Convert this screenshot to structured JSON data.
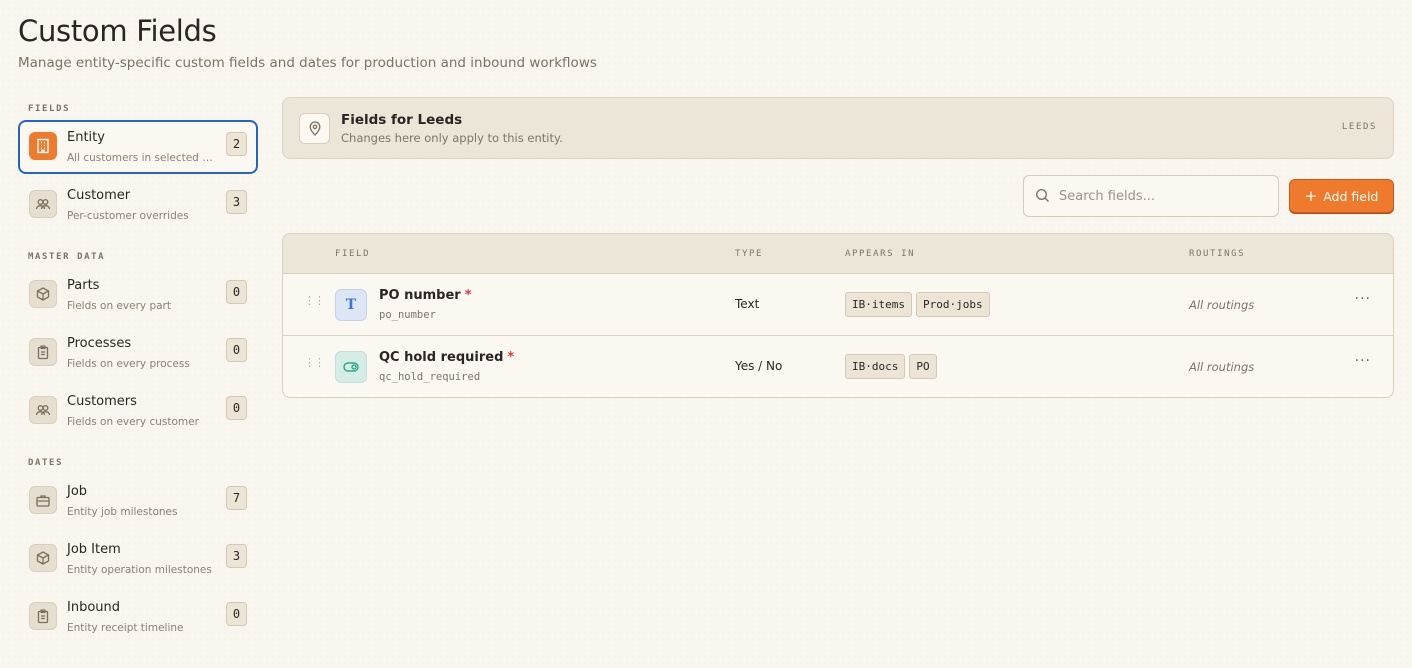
{
  "page": {
    "title": "Custom Fields",
    "subtitle": "Manage entity-specific custom fields and dates for production and inbound workflows"
  },
  "sidebar": {
    "sections": [
      {
        "heading": "FIELDS",
        "items": [
          {
            "label": "Entity",
            "sub": "All customers in selected entity",
            "count": "2",
            "icon": "building-icon",
            "active": true
          },
          {
            "label": "Customer",
            "sub": "Per-customer overrides",
            "count": "3",
            "icon": "users-icon"
          }
        ]
      },
      {
        "heading": "MASTER DATA",
        "items": [
          {
            "label": "Parts",
            "sub": "Fields on every part",
            "count": "0",
            "icon": "box-icon"
          },
          {
            "label": "Processes",
            "sub": "Fields on every process",
            "count": "0",
            "icon": "clipboard-icon"
          },
          {
            "label": "Customers",
            "sub": "Fields on every customer",
            "count": "0",
            "icon": "users-icon"
          }
        ]
      },
      {
        "heading": "DATES",
        "items": [
          {
            "label": "Job",
            "sub": "Entity job milestones",
            "count": "7",
            "icon": "briefcase-icon"
          },
          {
            "label": "Job Item",
            "sub": "Entity operation milestones",
            "count": "3",
            "icon": "box-icon"
          },
          {
            "label": "Inbound",
            "sub": "Entity receipt timeline",
            "count": "0",
            "icon": "clipboard-icon"
          }
        ]
      }
    ]
  },
  "banner": {
    "title": "Fields for Leeds",
    "subtitle": "Changes here only apply to this entity.",
    "tag": "LEEDS",
    "icon": "map-pin-icon"
  },
  "toolbar": {
    "search_placeholder": "Search fields...",
    "search_value": "",
    "add_label": "Add field"
  },
  "table": {
    "columns": {
      "field": "FIELD",
      "type": "TYPE",
      "appears_in": "APPEARS IN",
      "routings": "ROUTINGS"
    },
    "rows": [
      {
        "name": "PO number",
        "key": "po_number",
        "type": "Text",
        "appears_in": [
          "IB·items",
          "Prod·jobs"
        ],
        "routings": "All routings",
        "required": true,
        "icon": "text-type-icon"
      },
      {
        "name": "QC hold required",
        "key": "qc_hold_required",
        "type": "Yes / No",
        "appears_in": [
          "IB·docs",
          "PO"
        ],
        "routings": "All routings",
        "required": true,
        "icon": "toggle-icon"
      }
    ]
  },
  "colors": {
    "accent": "#f07a2c",
    "active_border": "#2563c9",
    "required": "#e0392f"
  }
}
